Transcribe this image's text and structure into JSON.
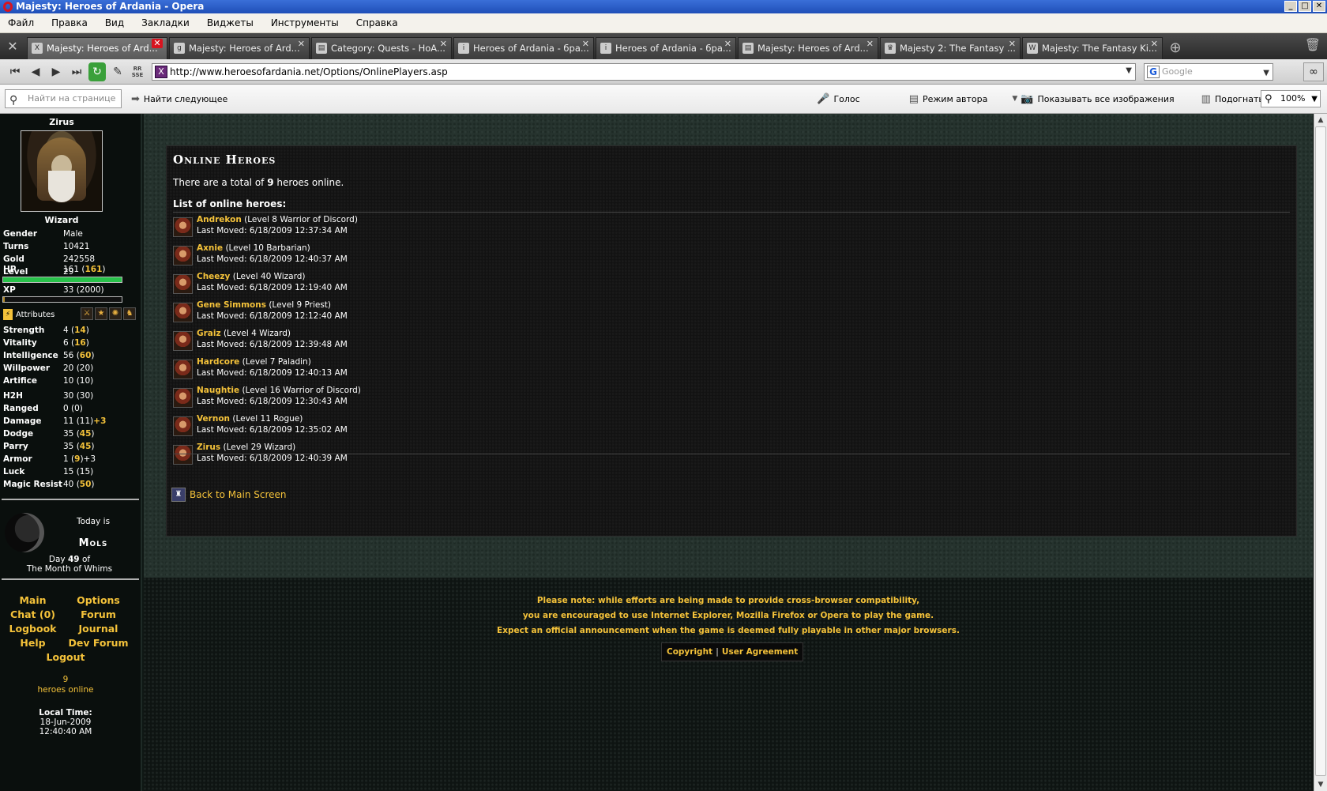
{
  "window": {
    "title": "Majesty: Heroes of Ardania - Opera"
  },
  "menu": [
    "Файл",
    "Правка",
    "Вид",
    "Закладки",
    "Виджеты",
    "Инструменты",
    "Справка"
  ],
  "tabs": [
    {
      "label": "Majesty: Heroes of Ard...",
      "icon": "X"
    },
    {
      "label": "Majesty: Heroes of Ard...",
      "icon": "g"
    },
    {
      "label": "Category: Quests - HoA...",
      "icon": "▤"
    },
    {
      "label": "Heroes of Ardania - бра...",
      "icon": "i"
    },
    {
      "label": "Heroes of Ardania - бра...",
      "icon": "i"
    },
    {
      "label": "Majesty: Heroes of Ard...",
      "icon": "▤"
    },
    {
      "label": "Majesty 2: The Fantasy ...",
      "icon": "♛"
    },
    {
      "label": "Majesty: The Fantasy Ki...",
      "icon": "W"
    }
  ],
  "address": {
    "url": "http://www.heroesofardania.net/Options/OnlinePlayers.asp",
    "rss_label": "RR SSE"
  },
  "search": {
    "placeholder": "Google"
  },
  "findbar": {
    "find_placeholder": "Найти на странице",
    "find_next": "Найти следующее",
    "voice": "Голос",
    "author_mode": "Режим автора",
    "show_images": "Показывать все изображения",
    "fit_width": "Подогнать по ширине",
    "zoom": "100%"
  },
  "sidebar": {
    "hero_name": "Zirus",
    "hero_class": "Wizard",
    "stats": [
      {
        "label": "Gender",
        "value": "Male"
      },
      {
        "label": "Turns",
        "value": "10421"
      },
      {
        "label": "Gold",
        "value": "242558"
      },
      {
        "label": "Level",
        "value": "29"
      }
    ],
    "hp_label": "HP",
    "hp_value": "161 (",
    "hp_max": "161",
    "hp_close": ")",
    "hp_fraction": 1.0,
    "xp_label": "XP",
    "xp_value": "33 (2000)",
    "xp_fraction": 0.0165,
    "attributes_label": "Attributes",
    "attributes": [
      {
        "label": "Strength",
        "base": "4 (",
        "mod": "14",
        "close": ")"
      },
      {
        "label": "Vitality",
        "base": "6 (",
        "mod": "16",
        "close": ")"
      },
      {
        "label": "Intelligence",
        "base": "56 (",
        "mod": "60",
        "close": ")"
      },
      {
        "label": "Willpower",
        "base": "20 (20)",
        "mod": "",
        "close": ""
      },
      {
        "label": "Artifice",
        "base": "10 (10)",
        "mod": "",
        "close": ""
      }
    ],
    "combat": [
      {
        "label": "H2H",
        "base": "30 (30)",
        "mod": "",
        "close": ""
      },
      {
        "label": "Ranged",
        "base": "0 (0)",
        "mod": "",
        "close": ""
      },
      {
        "label": "Damage",
        "base": "11 (11)",
        "mod": "+3",
        "close": ""
      },
      {
        "label": "Dodge",
        "base": "35 (",
        "mod": "45",
        "close": ")"
      },
      {
        "label": "Parry",
        "base": "35 (",
        "mod": "45",
        "close": ")"
      },
      {
        "label": "Armor",
        "base": "1 (",
        "mod": "9",
        "close": ")+3"
      },
      {
        "label": "Luck",
        "base": "15 (15)",
        "mod": "",
        "close": ""
      },
      {
        "label": "Magic Resist",
        "base": "40 (",
        "mod": "50",
        "close": ")"
      }
    ],
    "today_is": "Today is",
    "day_name": "Mols",
    "day_prefix": "Day",
    "day_number": "49",
    "day_suffix": "of",
    "month": "The Month of Whims",
    "nav": {
      "main": "Main",
      "options": "Options",
      "chat": "Chat (0)",
      "forum": "Forum",
      "logbook": "Logbook",
      "journal": "Journal",
      "help": "Help",
      "dev_forum": "Dev Forum",
      "logout": "Logout"
    },
    "online_count": "9",
    "online_label": "heroes online",
    "local_time_label": "Local Time:",
    "local_date": "18-Jun-2009",
    "local_time": "12:40:40 AM"
  },
  "content": {
    "title": "Online Heroes",
    "total_prefix": "There are a total of",
    "total_count": "9",
    "total_suffix": "heroes online.",
    "list_heading": "List of online heroes:",
    "heroes": [
      {
        "name": "Andrekon",
        "desc": "(Level 8 Warrior of Discord)",
        "moved": "Last Moved: 6/18/2009 12:37:34 AM"
      },
      {
        "name": "Axnie",
        "desc": "(Level 10 Barbarian)",
        "moved": "Last Moved: 6/18/2009 12:40:37 AM"
      },
      {
        "name": "Cheezy",
        "desc": "(Level 40 Wizard)",
        "moved": "Last Moved: 6/18/2009 12:19:40 AM"
      },
      {
        "name": "Gene Simmons",
        "desc": "(Level 9 Priest)",
        "moved": "Last Moved: 6/18/2009 12:12:40 AM"
      },
      {
        "name": "Graiz",
        "desc": "(Level 4 Wizard)",
        "moved": "Last Moved: 6/18/2009 12:39:48 AM"
      },
      {
        "name": "Hardcore",
        "desc": "(Level 7 Paladin)",
        "moved": "Last Moved: 6/18/2009 12:40:13 AM"
      },
      {
        "name": "Naughtie",
        "desc": "(Level 16 Warrior of Discord)",
        "moved": "Last Moved: 6/18/2009 12:30:43 AM"
      },
      {
        "name": "Vernon",
        "desc": "(Level 11 Rogue)",
        "moved": "Last Moved: 6/18/2009 12:35:02 AM"
      },
      {
        "name": "Zirus",
        "desc": "(Level 29 Wizard)",
        "moved": "Last Moved: 6/18/2009 12:40:39 AM"
      }
    ],
    "back_link": "Back to Main Screen"
  },
  "footer": {
    "note_lines": [
      "Please note: while efforts are being made to provide cross-browser compatibility,",
      "you are encouraged to use Internet Explorer, Mozilla Firefox or Opera to play the game.",
      "Expect an official announcement when the game is deemed fully playable in other major browsers."
    ],
    "copyright": "Copyright",
    "separator": "|",
    "agreement": "User Agreement"
  },
  "colors": {
    "accent": "#f4c23a",
    "hp": "#28c24a",
    "panel": "#121212"
  }
}
